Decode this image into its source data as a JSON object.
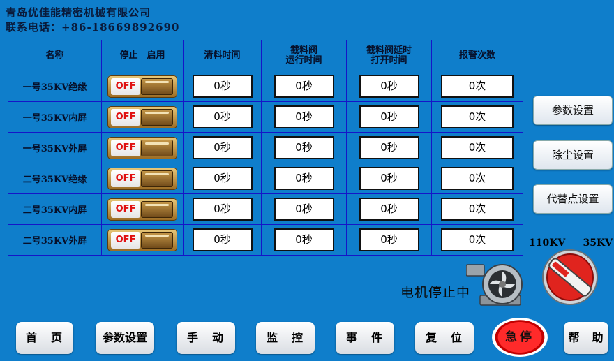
{
  "header": {
    "company": "青岛优佳能精密机械有限公司",
    "contact": "联系电话：+86-18669892690"
  },
  "table": {
    "columns": [
      "名称",
      "停止　启用",
      "清料时间",
      "截料阀\n运行时间",
      "截料阀延时\n打开时间",
      "报警次数"
    ],
    "rows": [
      {
        "name": "一号35KV绝缘",
        "toggle": "OFF",
        "clean": "0秒",
        "run": "0秒",
        "delay": "0秒",
        "alarms": "0次"
      },
      {
        "name": "一号35KV内屏",
        "toggle": "OFF",
        "clean": "0秒",
        "run": "0秒",
        "delay": "0秒",
        "alarms": "0次"
      },
      {
        "name": "一号35KV外屏",
        "toggle": "OFF",
        "clean": "0秒",
        "run": "0秒",
        "delay": "0秒",
        "alarms": "0次"
      },
      {
        "name": "二号35KV绝缘",
        "toggle": "OFF",
        "clean": "0秒",
        "run": "0秒",
        "delay": "0秒",
        "alarms": "0次"
      },
      {
        "name": "二号35KV内屏",
        "toggle": "OFF",
        "clean": "0秒",
        "run": "0秒",
        "delay": "0秒",
        "alarms": "0次"
      },
      {
        "name": "二号35KV外屏",
        "toggle": "OFF",
        "clean": "0秒",
        "run": "0秒",
        "delay": "0秒",
        "alarms": "0次"
      }
    ]
  },
  "side": {
    "params": "参数设置",
    "dust": "除尘设置",
    "substitute": "代替点设置"
  },
  "switch": {
    "left_label": "110KV",
    "right_label": "35KV"
  },
  "motor": {
    "status": "电机停止中"
  },
  "nav": {
    "home": "首　页",
    "params": "参数设置",
    "manual": "手　动",
    "monitor": "监　控",
    "events": "事　件",
    "reset": "复　位",
    "estop": "急停",
    "help": "帮　助"
  },
  "colors": {
    "background": "#0f7ecb",
    "grid_line": "#1515c8",
    "estop": "#ff2a2a"
  }
}
